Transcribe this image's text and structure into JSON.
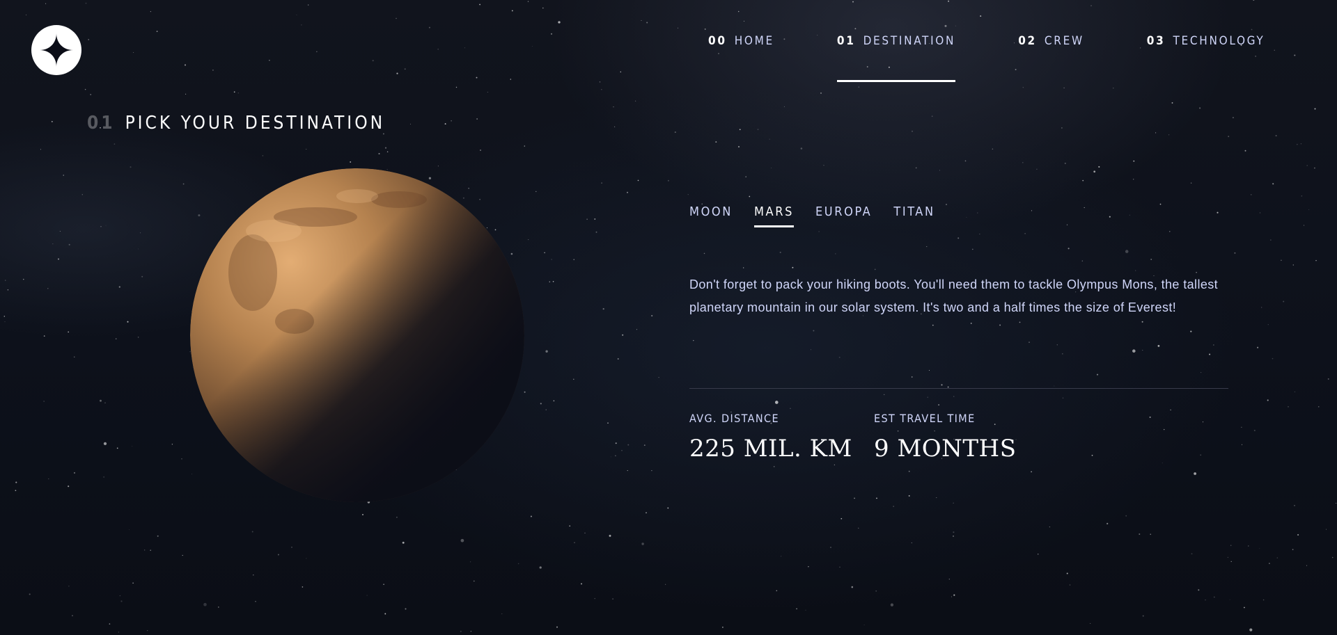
{
  "logo": {
    "icon": "star-icon"
  },
  "nav": {
    "items": [
      {
        "num": "00",
        "label": "HOME",
        "active": false
      },
      {
        "num": "01",
        "label": "DESTINATION",
        "active": true
      },
      {
        "num": "02",
        "label": "CREW",
        "active": false
      },
      {
        "num": "03",
        "label": "TECHNOLOGY",
        "active": false
      }
    ]
  },
  "heading": {
    "num": "01",
    "text": "PICK YOUR DESTINATION"
  },
  "planet": {
    "name": "mars-planet-image",
    "colors": {
      "light": "#d9a36a",
      "mid": "#a9764a",
      "shadow": "#0b0d17"
    }
  },
  "tabs": [
    {
      "label": "MOON",
      "active": false
    },
    {
      "label": "MARS",
      "active": true
    },
    {
      "label": "EUROPA",
      "active": false
    },
    {
      "label": "TITAN",
      "active": false
    }
  ],
  "description": "Don't forget to pack your hiking boots. You'll need them to tackle Olympus Mons, the tallest planetary mountain in our solar system. It's two and a half times the size of Everest!",
  "stats": {
    "distance": {
      "label": "AVG. DISTANCE",
      "value": "225 MIL. KM"
    },
    "travel": {
      "label": "EST TRAVEL TIME",
      "value": "9 MONTHS"
    }
  },
  "colors": {
    "background": "#0b0d17",
    "text_secondary": "#d0d6f9",
    "divider": "#383b4b"
  }
}
